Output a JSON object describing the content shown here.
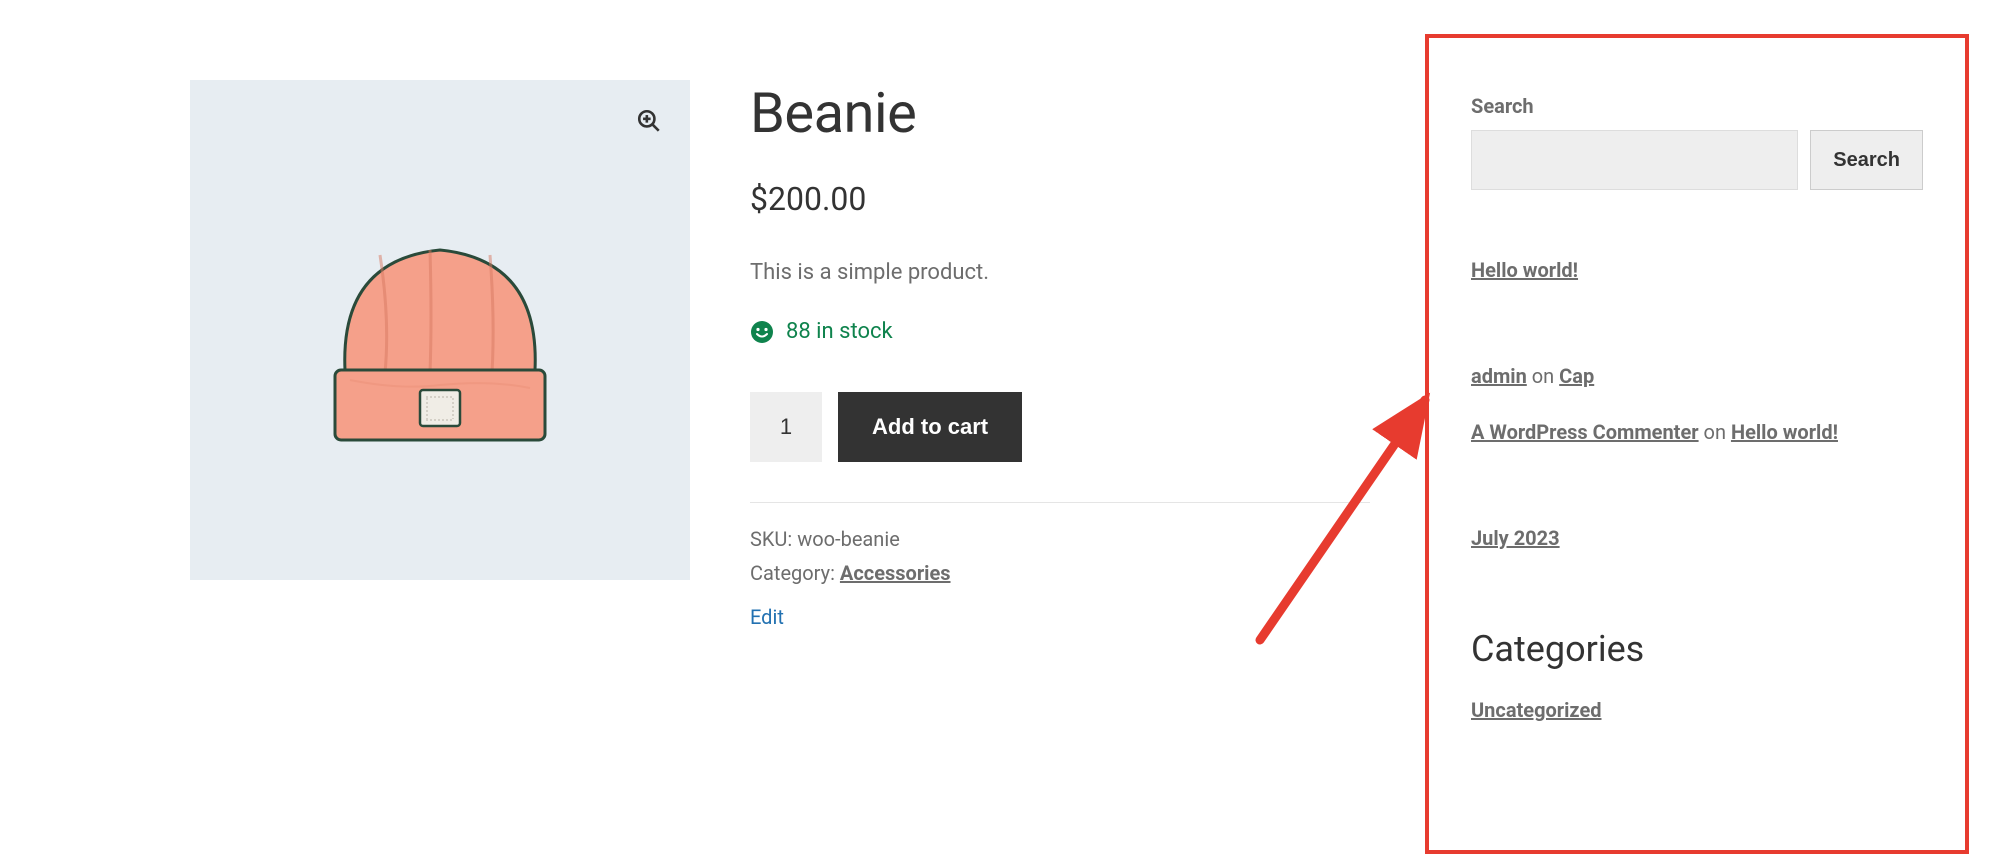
{
  "product": {
    "title": "Beanie",
    "price": "$200.00",
    "description": "This is a simple product.",
    "stock_text": "88 in stock",
    "qty_value": "1",
    "add_to_cart_label": "Add to cart",
    "sku_label": "SKU:",
    "sku_value": "woo-beanie",
    "category_label": "Category:",
    "category_link": "Accessories",
    "edit_label": "Edit"
  },
  "sidebar": {
    "search_label": "Search",
    "search_button": "Search",
    "recent_post": "Hello world!",
    "comment1_author": "admin",
    "comment1_on": " on ",
    "comment1_post": "Cap",
    "comment2_author": "A WordPress Commenter",
    "comment2_on": " on ",
    "comment2_post": "Hello world!",
    "archive_link": "July 2023",
    "categories_heading": "Categories",
    "category_link": "Uncategorized"
  },
  "colors": {
    "annotation": "#e73b2f",
    "stock_green": "#0f834d"
  }
}
